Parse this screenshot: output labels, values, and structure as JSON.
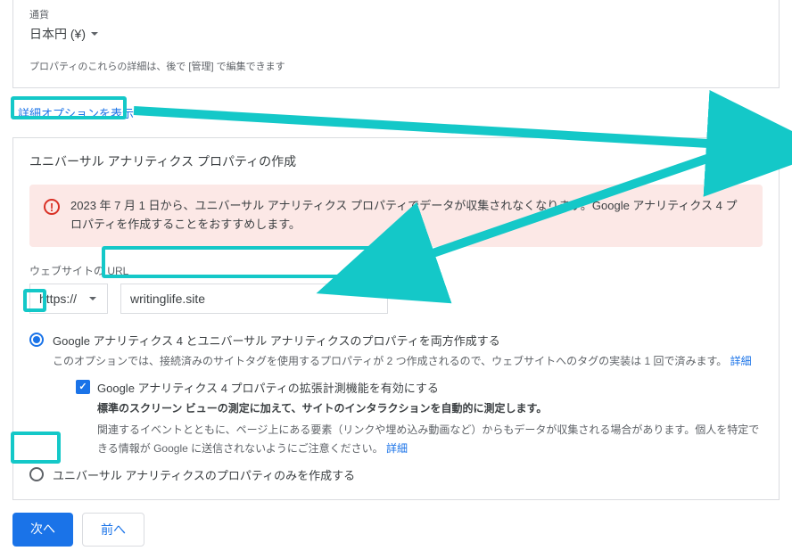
{
  "currency": {
    "label": "通貨",
    "value": "日本円 (¥)",
    "footnote": "プロパティのこれらの詳細は、後で [管理] で編集できます"
  },
  "advanced_link": "詳細オプションを表示",
  "ua": {
    "header": "ユニバーサル アナリティクス プロパティの作成",
    "toggle_on": true,
    "warning": "2023 年 7 月 1 日から、ユニバーサル アナリティクス プロパティでデータが収集されなくなります。Google アナリティクス 4 プロパティを作成することをおすすめします。",
    "url_label": "ウェブサイトの URL",
    "protocol": "https://",
    "url_value": "writinglife.site",
    "opt_both": {
      "label": "Google アナリティクス 4 とユニバーサル アナリティクスのプロパティを両方作成する",
      "sub": "このオプションでは、接続済みのサイトタグを使用するプロパティが 2 つ作成されるので、ウェブサイトへのタグの実装は 1 回で済みます。",
      "details": "詳細",
      "enhanced_label": "Google アナリティクス 4 プロパティの拡張計測機能を有効にする",
      "enhanced_sub1": "標準のスクリーン ビューの測定に加えて、サイトのインタラクションを自動的に測定します。",
      "enhanced_sub2": "関連するイベントとともに、ページ上にある要素（リンクや埋め込み動画など）からもデータが収集される場合があります。個人を特定できる情報が Google に送信されないようにご注意ください。",
      "enhanced_details": "詳細"
    },
    "opt_ua_only": "ユニバーサル アナリティクスのプロパティのみを作成する"
  },
  "buttons": {
    "next": "次へ",
    "prev": "前へ"
  }
}
